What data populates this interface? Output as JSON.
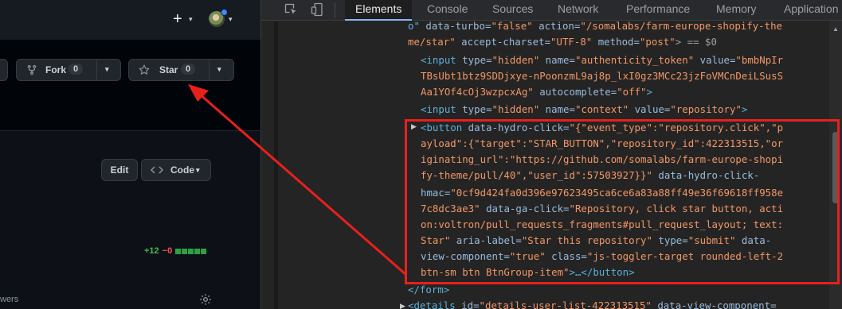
{
  "github": {
    "header": {
      "plus_icon": "+",
      "caret": "▾"
    },
    "buttons": {
      "fork_label": "Fork",
      "fork_count": "0",
      "star_label": "Star",
      "star_count": "0",
      "edit_label": "Edit",
      "code_label": "Code"
    },
    "diffstat": {
      "additions": "+12",
      "deletions": "−0"
    },
    "footer_text": "wers"
  },
  "devtools": {
    "tabs": [
      "Elements",
      "Console",
      "Sources",
      "Network",
      "Performance",
      "Memory",
      "Application"
    ],
    "active_tab": "Elements",
    "colors": {
      "tag": "#5db0d7",
      "attribute": "#9bbbdc",
      "value": "#f29766",
      "highlight_box": "#e8201c"
    },
    "lines": {
      "l1": {
        "tag_open": "o\"",
        "attr1": " data-turbo=",
        "val1": "\"false\"",
        "attr2": " action=",
        "val2": "\"/somalabs/farm-europe-shopify-the"
      },
      "l2": {
        "val1": "me/star\"",
        "attr1": " accept-charset=",
        "val2": "\"UTF-8\"",
        "attr2": " method=",
        "val3": "\"post\"",
        "tail": "> == $0"
      },
      "l3": {
        "tag": "<input",
        "attr1": " type=",
        "val1": "\"hidden\"",
        "attr2": " name=",
        "val2": "\"authenticity_token\"",
        "attr3": " value=",
        "val3": "\"bmbNpIr"
      },
      "l4": {
        "val": "TBsUbt1btz9SDDjxye-nPoonzmL9aj8p_lxI0gz3MCc23jzFoVMCnDeiLSusS"
      },
      "l5": {
        "val": "Aa1YOf4cOj3wzpcxAg\"",
        "attr": " autocomplete=",
        "val2": "\"off\"",
        "close": ">"
      },
      "l6": {
        "tag": "<input",
        "attr1": " type=",
        "val1": "\"hidden\"",
        "attr2": " name=",
        "val2": "\"context\"",
        "attr3": " value=",
        "val3": "\"repository\"",
        "close": ">"
      },
      "l7": {
        "tag": "<button",
        "attr": " data-hydro-click=",
        "val": "\"{\"event_type\":\"repository.click\",\"p"
      },
      "l8": {
        "val": "ayload\":{\"target\":\"STAR_BUTTON\",\"repository_id\":422313515,\"or"
      },
      "l9": {
        "val": "iginating_url\":\"https://github.com/somalabs/farm-europe-shopi"
      },
      "l10": {
        "val": "fy-theme/pull/40\",\"user_id\":57503927}}\"",
        "attr": " data-hydro-click-"
      },
      "l11": {
        "attr": "hmac=",
        "val": "\"0cf9d424fa0d396e97623495ca6ce6a83a88ff49e36f69618ff958e"
      },
      "l12": {
        "val": "7c8dc3ae3\"",
        "attr": " data-ga-click=",
        "val2": "\"Repository, click star button, acti"
      },
      "l13": {
        "val": "on:voltron/pull_requests_fragments#pull_request_layout; text:"
      },
      "l14": {
        "val": "Star\"",
        "attr1": " aria-label=",
        "val2": "\"Star this repository\"",
        "attr2": " type=",
        "val3": "\"submit\"",
        "attr3": " data-"
      },
      "l15": {
        "attr": "view-component=",
        "val": "\"true\"",
        "attr2": " class=",
        "val2": "\"js-toggler-target rounded-left-2"
      },
      "l16": {
        "val": "btn-sm btn BtnGroup-item\"",
        "mid": ">…",
        "close": "</button>"
      },
      "l17": {
        "tag": "</form>"
      },
      "l18": {
        "tag": "<details",
        "attr": " id=",
        "val": "\"details-user-list-422313515\"",
        "attr2": " data-view-component="
      }
    }
  }
}
